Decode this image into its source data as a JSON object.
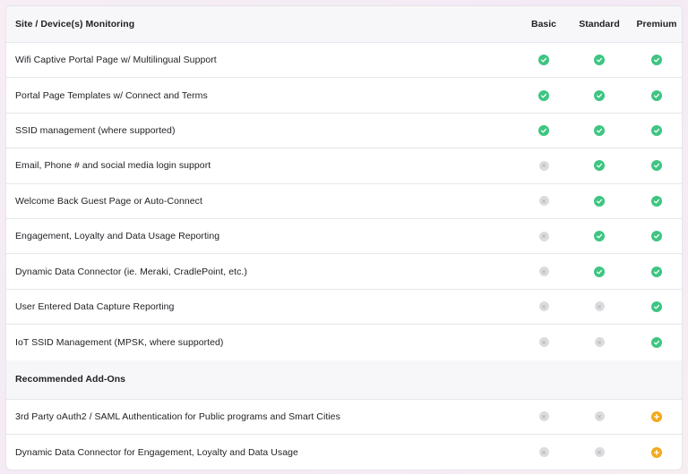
{
  "header": {
    "title": "Site / Device(s) Monitoring",
    "plans": [
      "Basic",
      "Standard",
      "Premium"
    ]
  },
  "features": [
    {
      "label": "Wifi Captive Portal Page w/ Multilingual Support",
      "basic": "check",
      "standard": "check",
      "premium": "check"
    },
    {
      "label": "Portal Page Templates w/ Connect and Terms",
      "basic": "check",
      "standard": "check",
      "premium": "check"
    },
    {
      "label": "SSID management (where supported)",
      "basic": "check",
      "standard": "check",
      "premium": "check"
    },
    {
      "label": "Email, Phone # and social media login support",
      "basic": "x",
      "standard": "check",
      "premium": "check"
    },
    {
      "label": "Welcome Back Guest Page or Auto-Connect",
      "basic": "x",
      "standard": "check",
      "premium": "check"
    },
    {
      "label": "Engagement, Loyalty and Data Usage Reporting",
      "basic": "x",
      "standard": "check",
      "premium": "check"
    },
    {
      "label": "Dynamic Data Connector (ie. Meraki, CradlePoint, etc.)",
      "basic": "x",
      "standard": "check",
      "premium": "check"
    },
    {
      "label": "User Entered Data Capture Reporting",
      "basic": "x",
      "standard": "x",
      "premium": "check"
    },
    {
      "label": "IoT SSID Management (MPSK, where supported)",
      "basic": "x",
      "standard": "x",
      "premium": "check"
    }
  ],
  "addons": {
    "title": "Recommended Add-Ons",
    "items": [
      {
        "label": "3rd Party oAuth2 / SAML Authentication for Public programs and Smart Cities",
        "basic": "x",
        "standard": "x",
        "premium": "plus"
      },
      {
        "label": "Dynamic Data Connector for Engagement, Loyalty and Data Usage",
        "basic": "x",
        "standard": "x",
        "premium": "plus"
      }
    ]
  },
  "colors": {
    "included": "#3ec582",
    "not_included": "#dcdcdf",
    "addon": "#f2a91c"
  },
  "icons": {
    "check": "check-circle-icon",
    "x": "x-circle-icon",
    "plus": "plus-circle-icon"
  }
}
